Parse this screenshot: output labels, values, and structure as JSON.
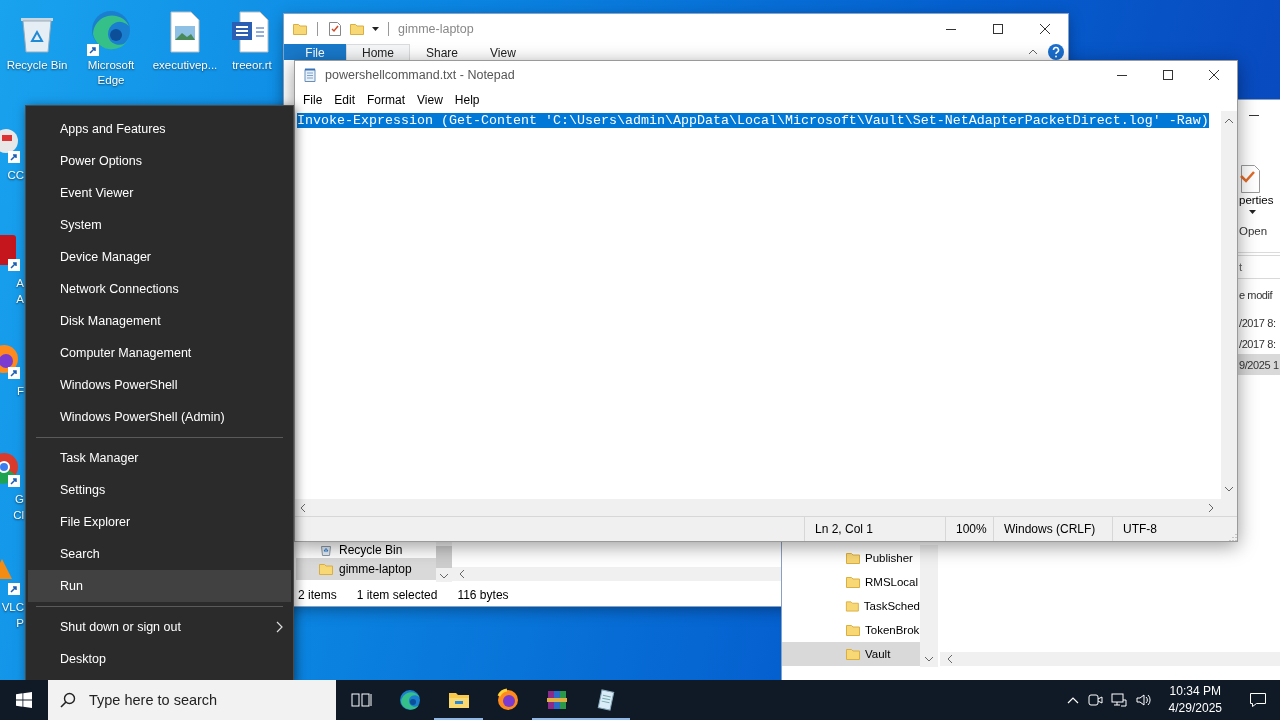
{
  "desktop_icons": [
    {
      "label": "Recycle Bin",
      "kind": "recycle"
    },
    {
      "label": "Microsoft Edge",
      "kind": "edge"
    },
    {
      "label": "executivep...",
      "kind": "image"
    },
    {
      "label": "treeor.rt",
      "kind": "word"
    }
  ],
  "left_icons": [
    {
      "kind": "ccleaner",
      "lines": [
        "CC"
      ]
    },
    {
      "kind": "acrobat",
      "lines": [
        "A",
        "A"
      ]
    },
    {
      "kind": "firefox",
      "lines": [
        "F"
      ]
    },
    {
      "kind": "chrome",
      "lines": [
        "G",
        "Cl"
      ]
    },
    {
      "kind": "vlc",
      "lines": [
        "VLC",
        "P"
      ]
    }
  ],
  "explorer": {
    "title": "gimme-laptop",
    "tabs": [
      {
        "label": "File",
        "kind": "file",
        "selected": false
      },
      {
        "label": "Home",
        "kind": "tab",
        "selected": true
      },
      {
        "label": "Share",
        "kind": "tab",
        "selected": false
      },
      {
        "label": "View",
        "kind": "tab",
        "selected": false
      }
    ],
    "nav": [
      {
        "label": "Recycle Bin",
        "kind": "recycle",
        "selected": false
      },
      {
        "label": "gimme-laptop",
        "kind": "folder",
        "selected": true
      }
    ],
    "status": [
      "2 items",
      "1 item selected",
      "116 bytes"
    ]
  },
  "explorer_2": {
    "ribbon_label": "perties",
    "ribbon_group": "Open",
    "address": "t",
    "column": "e modif",
    "rows": [
      {
        "text": "/2017 8:",
        "selected": false
      },
      {
        "text": "/2017 8:",
        "selected": false
      },
      {
        "text": "9/2025 1",
        "selected": true
      }
    ],
    "nav": [
      {
        "label": "Publisher",
        "selected": false
      },
      {
        "label": "RMSLocal",
        "selected": false
      },
      {
        "label": "TaskSched",
        "selected": false
      },
      {
        "label": "TokenBrok",
        "selected": false
      },
      {
        "label": "Vault",
        "selected": true
      }
    ]
  },
  "notepad": {
    "title": "powershellcommand.txt - Notepad",
    "menu": [
      "File",
      "Edit",
      "Format",
      "View",
      "Help"
    ],
    "text": "Invoke-Expression (Get-Content 'C:\\Users\\admin\\AppData\\Local\\Microsoft\\Vault\\Set-NetAdapterPacketDirect.log' -Raw)",
    "text_selected": true,
    "status": [
      "Ln 2, Col 1",
      "100%",
      "Windows (CRLF)",
      "UTF-8"
    ]
  },
  "context_menu": {
    "groups": [
      {
        "items": [
          {
            "label": "Apps and Features",
            "selected": false,
            "submenu": false
          },
          {
            "label": "Power Options",
            "selected": false,
            "submenu": false
          },
          {
            "label": "Event Viewer",
            "selected": false,
            "submenu": false
          },
          {
            "label": "System",
            "selected": false,
            "submenu": false
          },
          {
            "label": "Device Manager",
            "selected": false,
            "submenu": false
          },
          {
            "label": "Network Connections",
            "selected": false,
            "submenu": false
          },
          {
            "label": "Disk Management",
            "selected": false,
            "submenu": false
          },
          {
            "label": "Computer Management",
            "selected": false,
            "submenu": false
          },
          {
            "label": "Windows PowerShell",
            "selected": false,
            "submenu": false
          },
          {
            "label": "Windows PowerShell (Admin)",
            "selected": false,
            "submenu": false
          }
        ]
      },
      {
        "items": [
          {
            "label": "Task Manager",
            "selected": false,
            "submenu": false
          },
          {
            "label": "Settings",
            "selected": false,
            "submenu": false
          },
          {
            "label": "File Explorer",
            "selected": false,
            "submenu": false
          },
          {
            "label": "Search",
            "selected": false,
            "submenu": false
          },
          {
            "label": "Run",
            "selected": true,
            "submenu": false
          }
        ]
      },
      {
        "items": [
          {
            "label": "Shut down or sign out",
            "selected": false,
            "submenu": true
          },
          {
            "label": "Desktop",
            "selected": false,
            "submenu": false
          }
        ]
      }
    ]
  },
  "taskbar": {
    "search_placeholder": "Type here to search",
    "apps": [
      {
        "kind": "taskview",
        "running": false
      },
      {
        "kind": "edge",
        "running": false
      },
      {
        "kind": "explorer",
        "running": true
      },
      {
        "kind": "firefox",
        "running": false
      },
      {
        "kind": "winrar",
        "running": true
      },
      {
        "kind": "notepad",
        "running": true
      }
    ],
    "time": "10:34 PM",
    "date": "4/29/2025"
  }
}
